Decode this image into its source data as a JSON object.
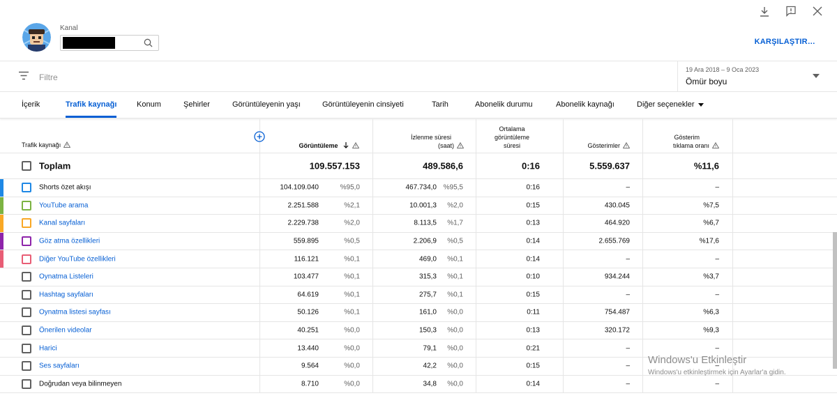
{
  "header": {
    "channel_label": "Kanal",
    "compare_label": "KARŞILAŞTIR…"
  },
  "filter": {
    "placeholder": "Filtre"
  },
  "date": {
    "range": "19 Ara 2018 – 9 Oca 2023",
    "value": "Ömür boyu"
  },
  "tabs": [
    {
      "label": "İçerik"
    },
    {
      "label": "Trafik kaynağı"
    },
    {
      "label": "Konum"
    },
    {
      "label": "Şehirler"
    },
    {
      "label": "Görüntüleyenin yaşı"
    },
    {
      "label": "Görüntüleyenin cinsiyeti"
    },
    {
      "label": "Tarih"
    },
    {
      "label": "Abonelik durumu"
    },
    {
      "label": "Abonelik kaynağı"
    },
    {
      "label": "Diğer seçenekler"
    }
  ],
  "table": {
    "headers": {
      "source": "Trafik kaynağı",
      "views": "Görüntüleme",
      "watch_1": "İzlenme süresi",
      "watch_2": "(saat)",
      "avg_1": "Ortalama",
      "avg_2": "görüntüleme",
      "avg_3": "süresi",
      "impressions": "Gösterimler",
      "ctr_1": "Gösterim",
      "ctr_2": "tıklama oranı"
    },
    "total": {
      "label": "Toplam",
      "views": "109.557.153",
      "watch": "489.586,6",
      "avg": "0:16",
      "impressions": "5.559.637",
      "ctr": "%11,6"
    },
    "rows": [
      {
        "label": "Shorts özet akışı",
        "link": false,
        "views": "104.109.040",
        "views_pct": "%95,0",
        "watch": "467.734,0",
        "watch_pct": "%95,5",
        "avg": "0:16",
        "impressions": "–",
        "ctr": "–"
      },
      {
        "label": "YouTube arama",
        "link": true,
        "views": "2.251.588",
        "views_pct": "%2,1",
        "watch": "10.001,3",
        "watch_pct": "%2,0",
        "avg": "0:15",
        "impressions": "430.045",
        "ctr": "%7,5"
      },
      {
        "label": "Kanal sayfaları",
        "link": true,
        "views": "2.229.738",
        "views_pct": "%2,0",
        "watch": "8.113,5",
        "watch_pct": "%1,7",
        "avg": "0:13",
        "impressions": "464.920",
        "ctr": "%6,7"
      },
      {
        "label": "Göz atma özellikleri",
        "link": true,
        "views": "559.895",
        "views_pct": "%0,5",
        "watch": "2.206,9",
        "watch_pct": "%0,5",
        "avg": "0:14",
        "impressions": "2.655.769",
        "ctr": "%17,6"
      },
      {
        "label": "Diğer YouTube özellikleri",
        "link": true,
        "views": "116.121",
        "views_pct": "%0,1",
        "watch": "469,0",
        "watch_pct": "%0,1",
        "avg": "0:14",
        "impressions": "–",
        "ctr": "–"
      },
      {
        "label": "Oynatma Listeleri",
        "link": true,
        "views": "103.477",
        "views_pct": "%0,1",
        "watch": "315,3",
        "watch_pct": "%0,1",
        "avg": "0:10",
        "impressions": "934.244",
        "ctr": "%3,7"
      },
      {
        "label": "Hashtag sayfaları",
        "link": true,
        "views": "64.619",
        "views_pct": "%0,1",
        "watch": "275,7",
        "watch_pct": "%0,1",
        "avg": "0:15",
        "impressions": "–",
        "ctr": "–"
      },
      {
        "label": "Oynatma listesi sayfası",
        "link": true,
        "views": "50.126",
        "views_pct": "%0,1",
        "watch": "161,0",
        "watch_pct": "%0,0",
        "avg": "0:11",
        "impressions": "754.487",
        "ctr": "%6,3"
      },
      {
        "label": "Önerilen videolar",
        "link": true,
        "views": "40.251",
        "views_pct": "%0,0",
        "watch": "150,3",
        "watch_pct": "%0,0",
        "avg": "0:13",
        "impressions": "320.172",
        "ctr": "%9,3"
      },
      {
        "label": "Harici",
        "link": true,
        "views": "13.440",
        "views_pct": "%0,0",
        "watch": "79,1",
        "watch_pct": "%0,0",
        "avg": "0:21",
        "impressions": "–",
        "ctr": "–"
      },
      {
        "label": "Ses sayfaları",
        "link": true,
        "views": "9.564",
        "views_pct": "%0,0",
        "watch": "42,2",
        "watch_pct": "%0,0",
        "avg": "0:15",
        "impressions": "–",
        "ctr": "–"
      },
      {
        "label": "Doğrudan veya bilinmeyen",
        "link": false,
        "views": "8.710",
        "views_pct": "%0,0",
        "watch": "34,8",
        "watch_pct": "%0,0",
        "avg": "0:14",
        "impressions": "–",
        "ctr": "–"
      }
    ]
  },
  "watermark": {
    "line1": "Windows'u Etkinleştir",
    "line2": "Windows'u etkinleştirmek için Ayarlar'a gidin."
  },
  "colors": {
    "accent": "#065fd4",
    "row_bars": [
      "#1e88e5",
      "#7cb342",
      "#f9a825",
      "#8e24aa",
      "#e85d75"
    ]
  }
}
